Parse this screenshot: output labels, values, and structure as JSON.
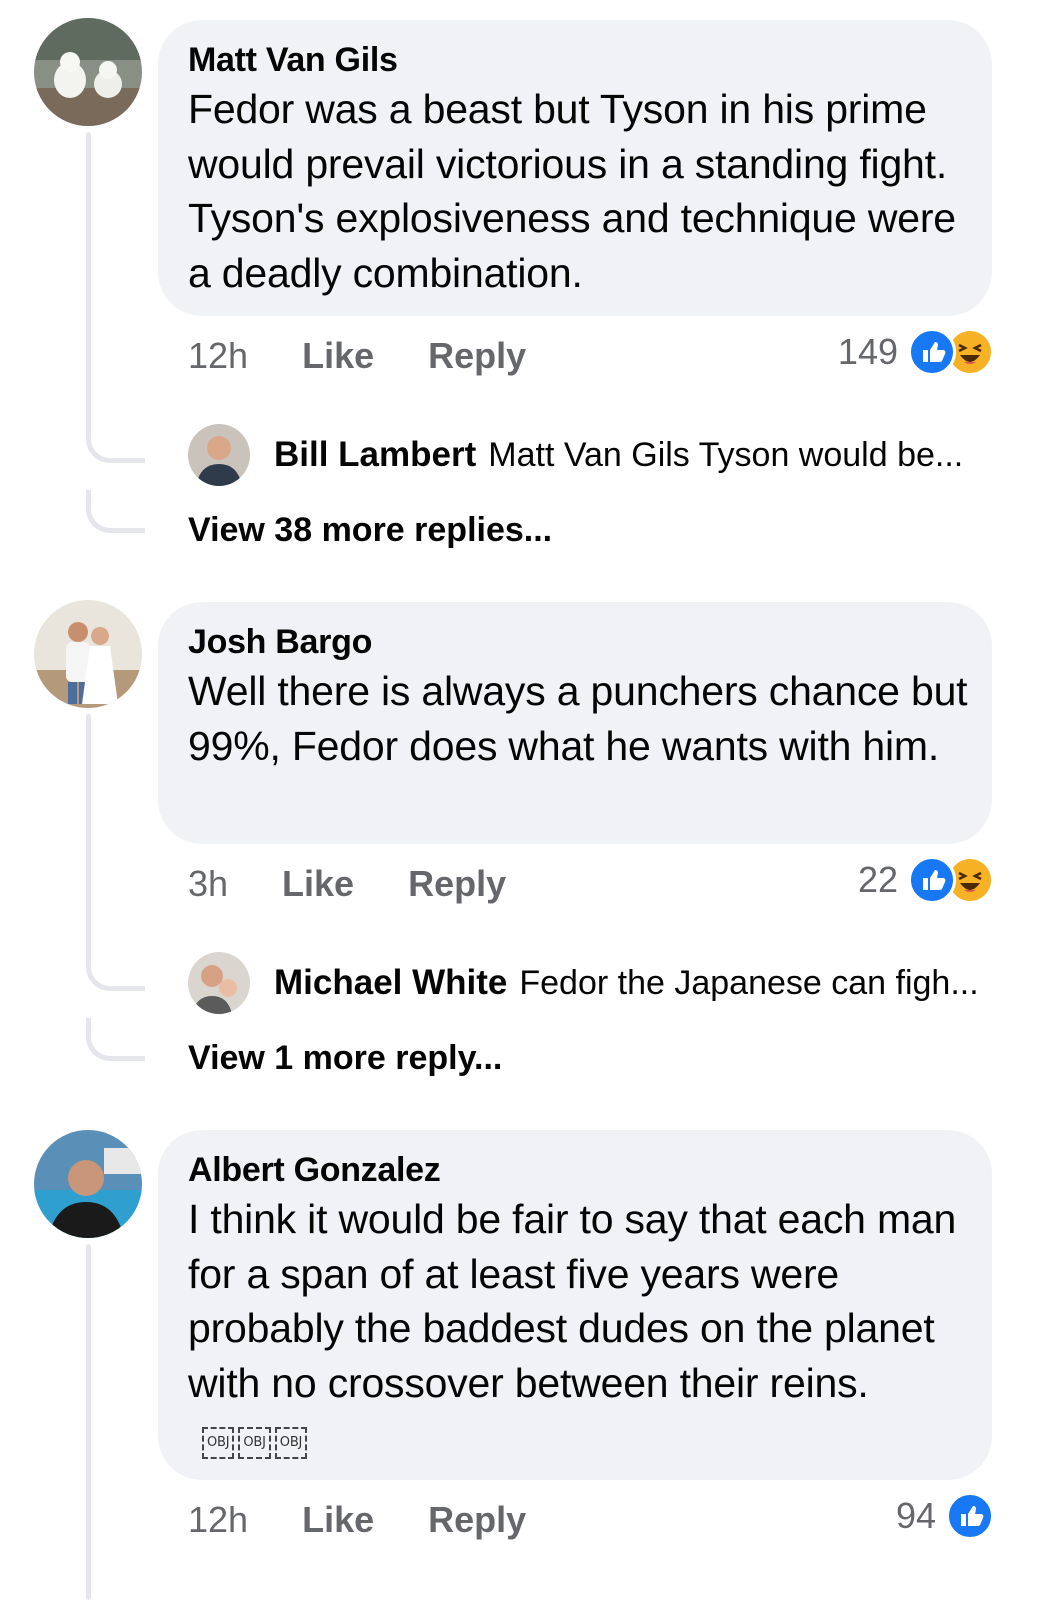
{
  "comments": [
    {
      "author": "Matt Van Gils",
      "text": "Fedor was a beast but Tyson in his prime would prevail victorious in a standing fight. Tyson's explosiveness and technique were a deadly combination.",
      "time": "12h",
      "like_label": "Like",
      "reply_label": "Reply",
      "reaction_count": "149",
      "reactions": [
        "like-icon",
        "haha-icon"
      ],
      "reply_preview": {
        "author": "Bill Lambert",
        "snippet": "Matt Van Gils Tyson would be..."
      },
      "view_more": "View 38 more replies..."
    },
    {
      "author": "Josh Bargo",
      "text": "Well there is always a punchers chance but 99%, Fedor does what he wants with him.",
      "time": "3h",
      "like_label": "Like",
      "reply_label": "Reply",
      "reaction_count": "22",
      "reactions": [
        "like-icon",
        "haha-icon"
      ],
      "reply_preview": {
        "author": "Michael White",
        "snippet": "Fedor the Japanese can figh..."
      },
      "view_more": "View 1 more reply..."
    },
    {
      "author": "Albert Gonzalez",
      "text": "I think it would be fair to say that each man for a span of at least five years were probably the baddest dudes on the planet with no crossover between their reins.",
      "emoji_placeholders": [
        "OBJ",
        "OBJ",
        "OBJ"
      ],
      "time": "12h",
      "like_label": "Like",
      "reply_label": "Reply",
      "reaction_count": "94",
      "reactions": [
        "like-icon"
      ]
    }
  ],
  "colors": {
    "bubble": "#f0f2f5",
    "meta": "#65676b",
    "like_blue": "#1877f2",
    "haha_yellow": "#f7b125",
    "thread_line": "#e4e6eb"
  }
}
